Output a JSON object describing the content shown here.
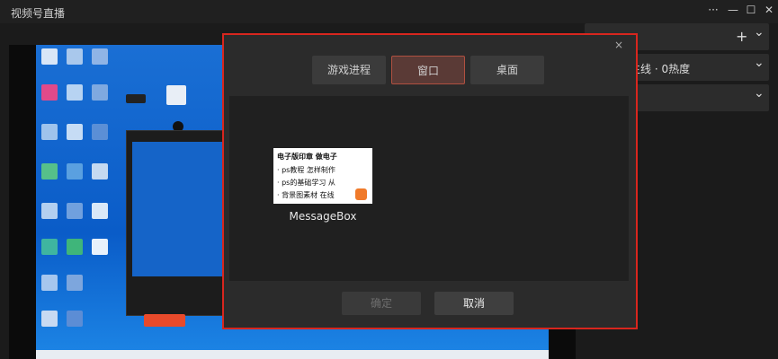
{
  "app": {
    "title": "视频号直播"
  },
  "window_controls": {
    "more": "···",
    "minimize": "—",
    "maximize": "☐",
    "close": "✕"
  },
  "right_panel": {
    "row1_add": "+",
    "row1_chevron": "⌄",
    "row2_text": "主线 · 0热度",
    "row2_chevron": "⌄",
    "row3_chevron": "⌄"
  },
  "modal": {
    "close": "×",
    "tabs": [
      {
        "label": "游戏进程",
        "active": false
      },
      {
        "label": "窗口",
        "active": true
      },
      {
        "label": "桌面",
        "active": false
      }
    ],
    "windows": [
      {
        "label": "MessageBox",
        "preview_lines": [
          "电子版印章  做电子",
          "· ps教程   怎样制作",
          "· ps的基础学习  从",
          "· 背景图素材  在线"
        ]
      }
    ],
    "confirm_label": "确定",
    "cancel_label": "取消"
  },
  "colors": {
    "accent": "#d8261e",
    "active_tab": "#5a3a36",
    "background": "#1b1b1b"
  }
}
